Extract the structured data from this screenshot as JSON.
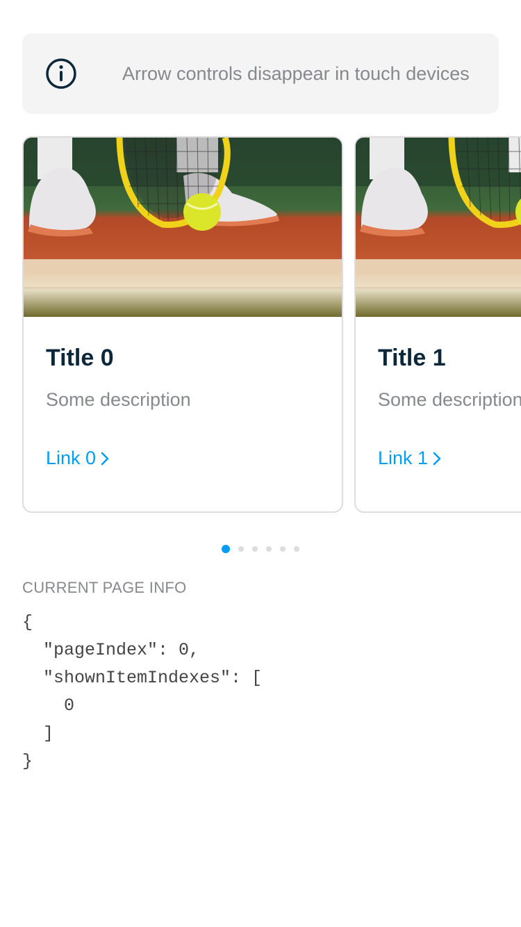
{
  "callout": {
    "text": "Arrow controls disappear in touch devices",
    "icon": "info-icon"
  },
  "carousel": {
    "cards": [
      {
        "title": "Title 0",
        "description": "Some description",
        "link": "Link 0",
        "image": "tennis-shoes-racket-ball-photo"
      },
      {
        "title": "Title 1",
        "description": "Some description",
        "link": "Link 1",
        "image": "tennis-shoes-racket-ball-photo"
      }
    ],
    "page_count": 6,
    "active_page": 0
  },
  "page_info": {
    "label": "CURRENT PAGE INFO",
    "code": "{\n  \"pageIndex\": 0,\n  \"shownItemIndexes\": [\n    0\n  ]\n}"
  },
  "colors": {
    "accent": "#019df4",
    "title": "#0b2739",
    "muted": "#86888c",
    "callout_bg": "#f4f4f4"
  }
}
